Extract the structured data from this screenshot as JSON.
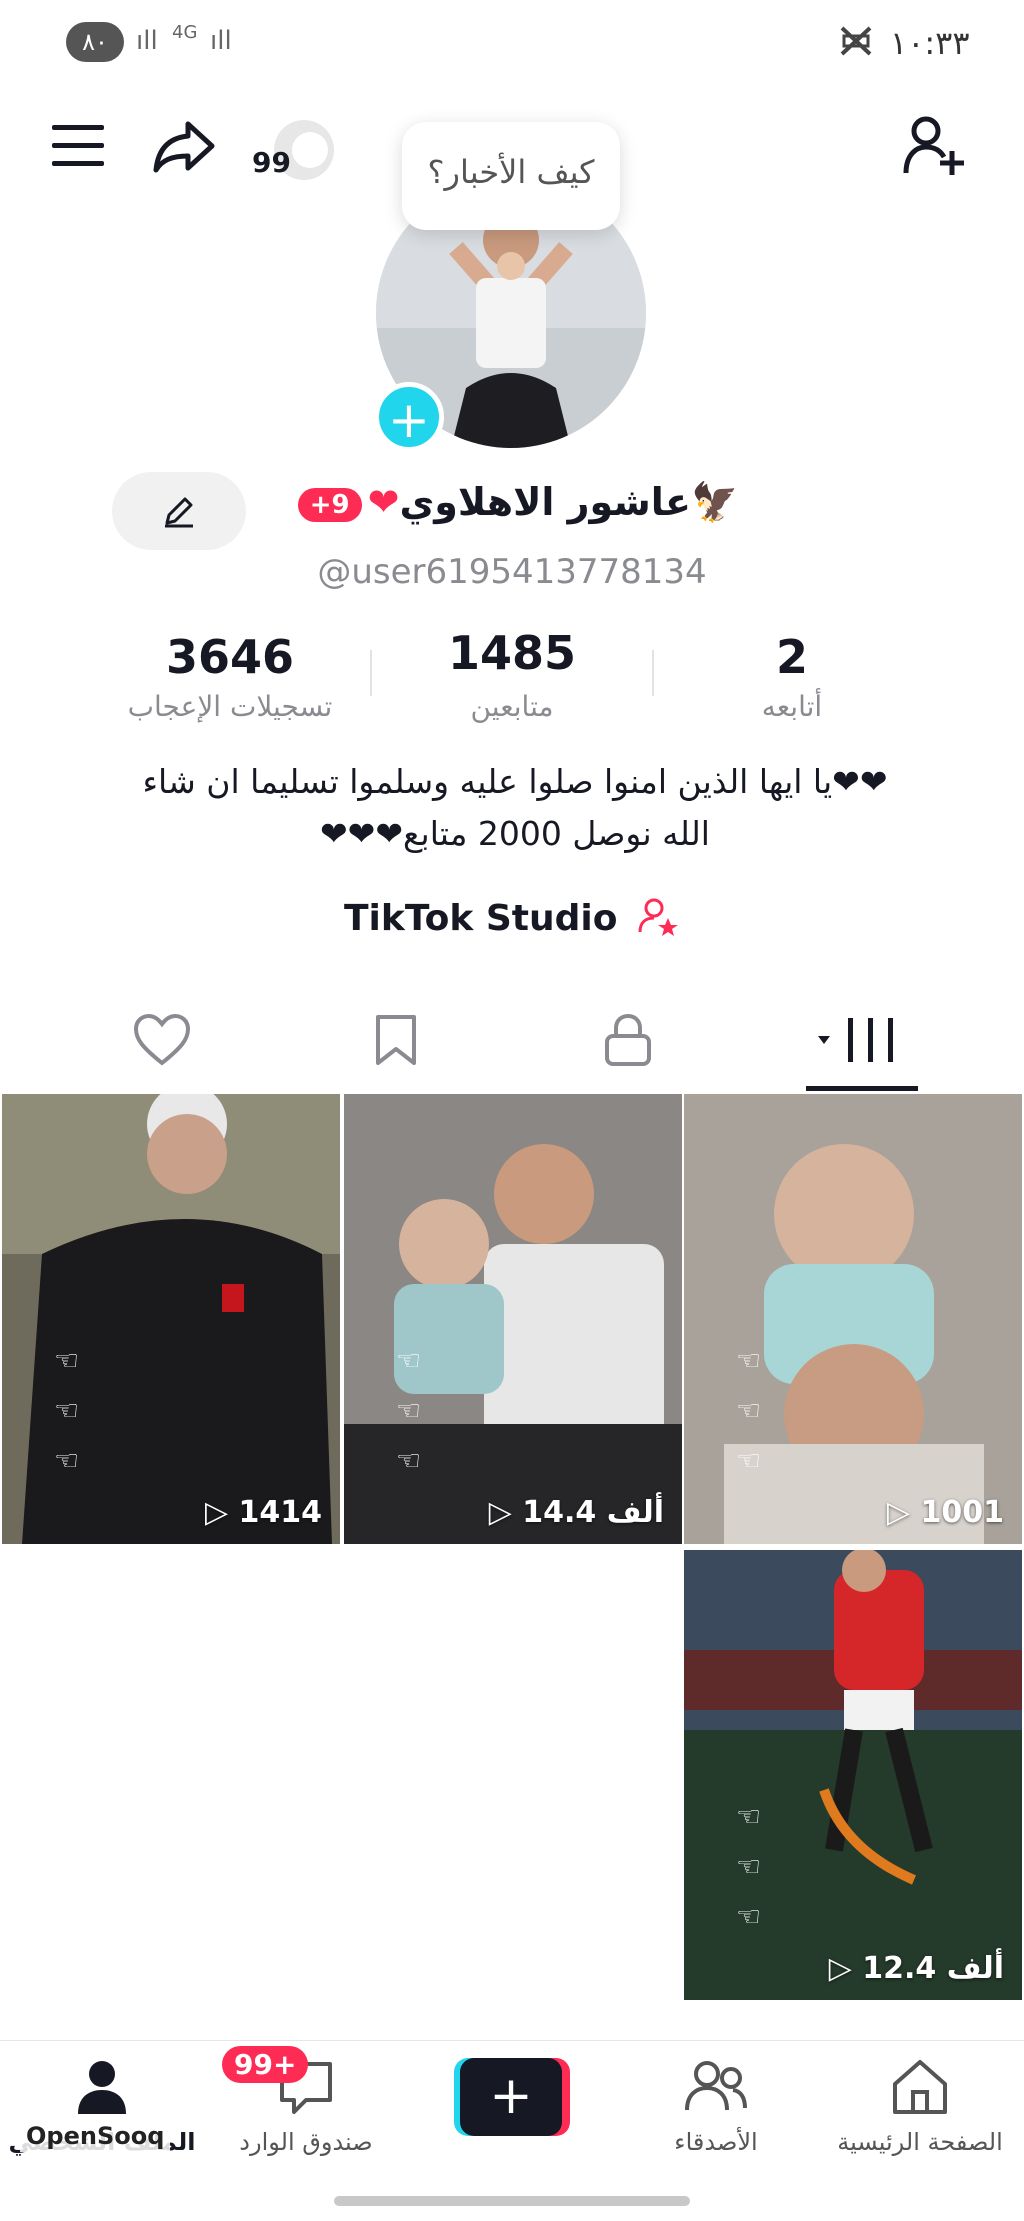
{
  "status_bar": {
    "time": "١٠:٣٣",
    "battery": "٨٠",
    "network": "4G"
  },
  "header": {
    "followers_badge": "99",
    "tooltip": "كيف الأخبار؟"
  },
  "profile": {
    "name": "عاشور الاهلاوي",
    "name_emoji": "🦅",
    "heart": "❤",
    "friends_badge": "9+",
    "username": "@user6195413778134"
  },
  "stats": [
    {
      "value": "2",
      "label": "أتابعه"
    },
    {
      "value": "1485",
      "label": "متابعين"
    },
    {
      "value": "3646",
      "label": "تسجيلات الإعجاب"
    }
  ],
  "bio": {
    "line1": "❤❤يا ايها الذين امنوا صلوا عليه وسلموا تسليما ان شاء",
    "line2": "الله نوصل 2000 متابع❤❤❤"
  },
  "studio_label": "TikTok Studio",
  "tabs": [
    "videos-grid",
    "private-lock",
    "saved-bookmark",
    "liked-heart"
  ],
  "videos": [
    {
      "views": "1001"
    },
    {
      "views": "14.4 ألف"
    },
    {
      "views": "1414"
    },
    {
      "views": "12.4 ألف"
    }
  ],
  "bottom_nav": {
    "home": "الصفحة الرئيسية",
    "friends": "الأصدقاء",
    "inbox": "صندوق الوارد",
    "inbox_badge": "99+",
    "profile": "الملف الشخصي"
  },
  "watermark": "OpenSooq",
  "colors": {
    "accent": "#fe2c55",
    "cyan": "#20d5ec",
    "text": "#161823",
    "muted": "#8a8b91"
  }
}
